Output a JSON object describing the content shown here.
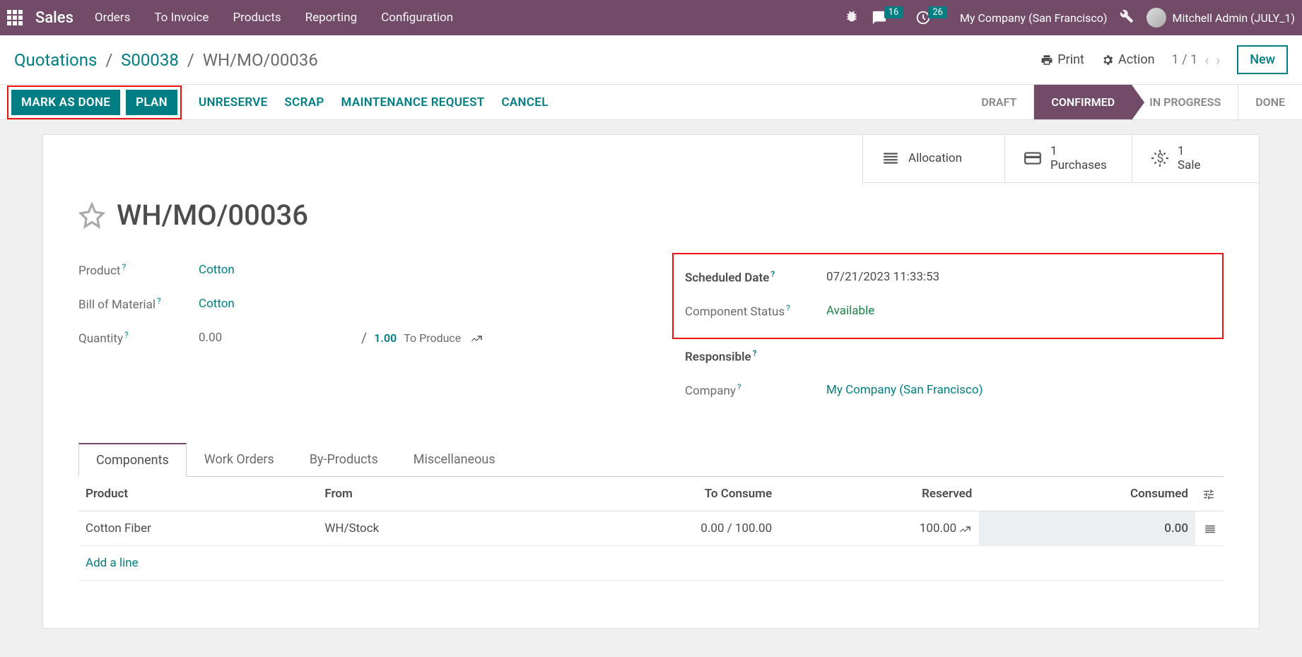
{
  "navbar": {
    "brand": "Sales",
    "menu": [
      "Orders",
      "To Invoice",
      "Products",
      "Reporting",
      "Configuration"
    ],
    "msg_badge": "16",
    "activity_badge": "26",
    "company": "My Company (San Francisco)",
    "user": "Mitchell Admin (JULY_1)"
  },
  "breadcrumb": {
    "root": "Quotations",
    "doc": "S00038",
    "leaf": "WH/MO/00036",
    "print": "Print",
    "action": "Action",
    "pager": "1 / 1",
    "new_btn": "New"
  },
  "actionbar": {
    "mark_done": "MARK AS DONE",
    "plan": "PLAN",
    "unreserve": "UNRESERVE",
    "scrap": "SCRAP",
    "maint": "MAINTENANCE REQUEST",
    "cancel": "CANCEL",
    "statuses": [
      "DRAFT",
      "CONFIRMED",
      "IN PROGRESS",
      "DONE"
    ]
  },
  "statboxes": {
    "allocation": "Allocation",
    "purchases_num": "1",
    "purchases_lbl": "Purchases",
    "sale_num": "1",
    "sale_lbl": "Sale"
  },
  "sheet": {
    "title": "WH/MO/00036",
    "labels": {
      "product": "Product",
      "bom": "Bill of Material",
      "quantity": "Quantity",
      "sched": "Scheduled Date",
      "compstat": "Component Status",
      "resp": "Responsible",
      "company": "Company"
    },
    "values": {
      "product": "Cotton",
      "bom": "Cotton",
      "qty": "0.00",
      "qty_total": "1.00",
      "qty_lbl": "To Produce",
      "sched": "07/21/2023 11:33:53",
      "compstat": "Available",
      "company": "My Company (San Francisco)"
    }
  },
  "tabs": [
    "Components",
    "Work Orders",
    "By-Products",
    "Miscellaneous"
  ],
  "table": {
    "headers": {
      "product": "Product",
      "from": "From",
      "to_consume": "To Consume",
      "reserved": "Reserved",
      "consumed": "Consumed"
    },
    "row": {
      "product": "Cotton Fiber",
      "from": "WH/Stock",
      "to_consume": "0.00 /   100.00",
      "reserved": "100.00",
      "consumed": "0.00"
    },
    "addline": "Add a line"
  }
}
